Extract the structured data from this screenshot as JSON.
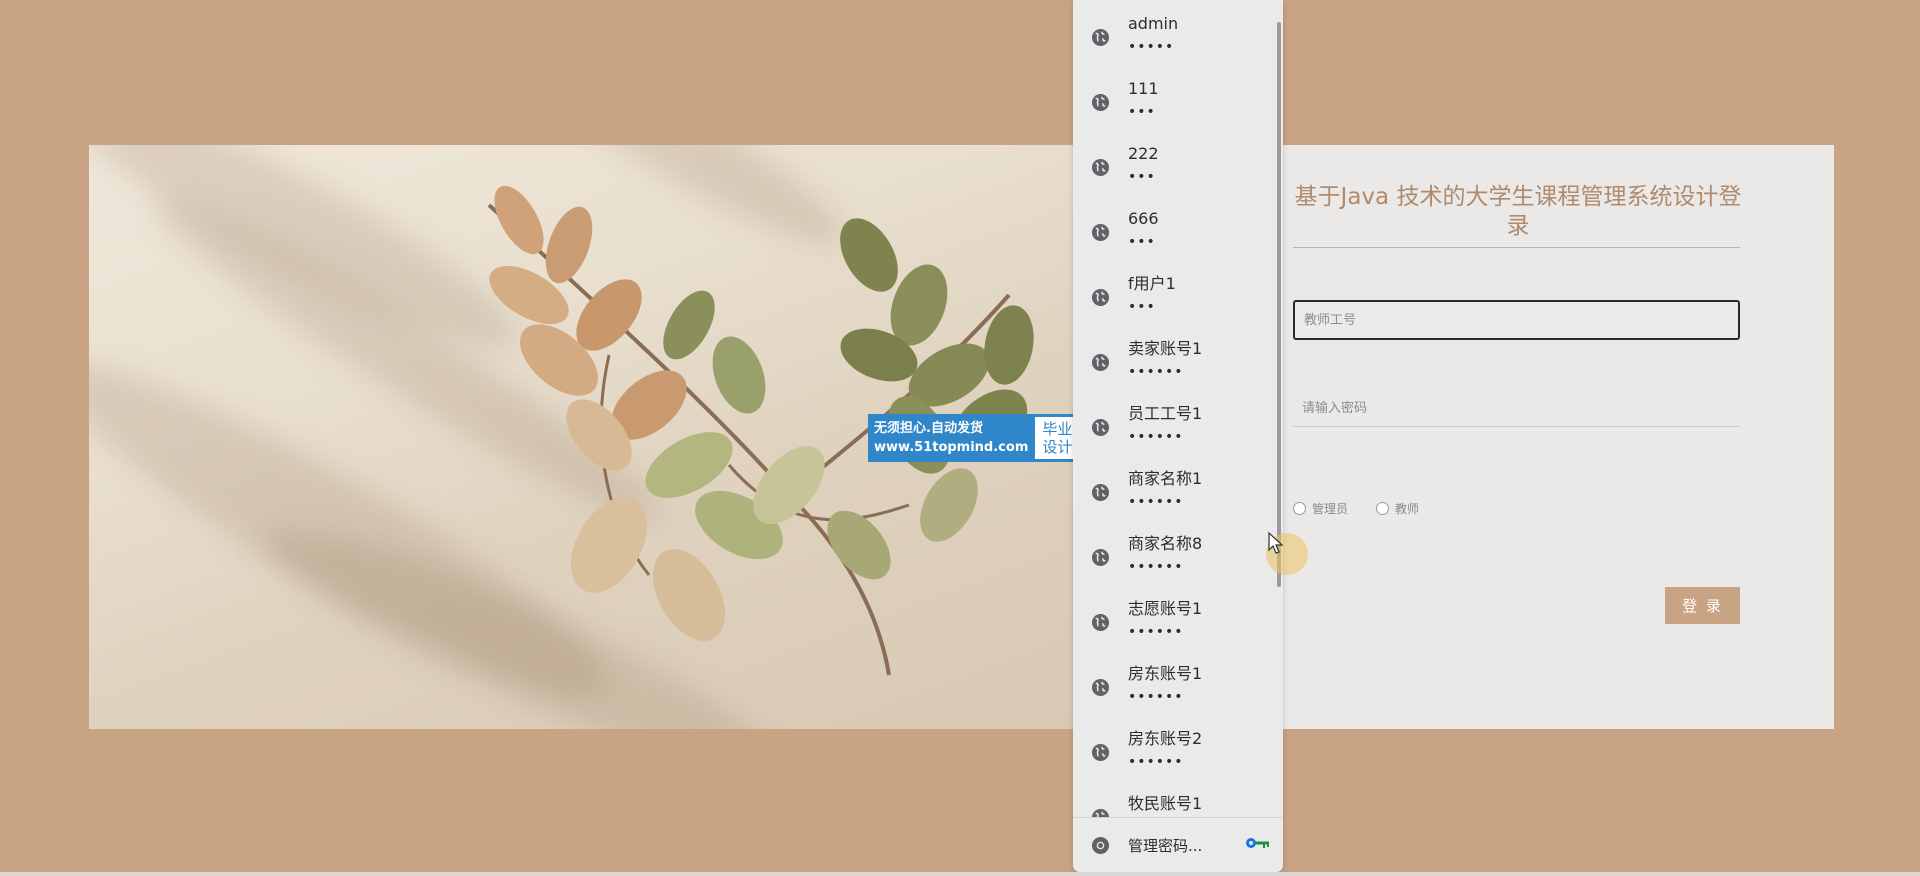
{
  "login": {
    "title": "基于Java 技术的大学生课程管理系统设计登录",
    "username_placeholder": "教师工号",
    "password_placeholder": "请输入密码",
    "roles": [
      "管理员",
      "教师"
    ],
    "login_button": "登 录"
  },
  "watermark": {
    "line1": "无须担心.自动发货",
    "line2": "www.51topmind.com",
    "badge_line1": "毕业",
    "badge_line2": "设计"
  },
  "autofill": {
    "items": [
      {
        "user": "admin",
        "password": "•••••"
      },
      {
        "user": "111",
        "password": "•••"
      },
      {
        "user": "222",
        "password": "•••"
      },
      {
        "user": "666",
        "password": "•••"
      },
      {
        "user": "f用户1",
        "password": "•••"
      },
      {
        "user": "卖家账号1",
        "password": "••••••"
      },
      {
        "user": "员工工号1",
        "password": "••••••"
      },
      {
        "user": "商家名称1",
        "password": "••••••"
      },
      {
        "user": "商家名称8",
        "password": "••••••"
      },
      {
        "user": "志愿账号1",
        "password": "••••••"
      },
      {
        "user": "房东账号1",
        "password": "••••••"
      },
      {
        "user": "房东账号2",
        "password": "••••••"
      },
      {
        "user": "牧民账号1",
        "password": "••••••"
      }
    ],
    "footer_label": "管理密码...",
    "item_icon": "globe-icon",
    "footer_icon": "chrome-icon",
    "key_icon": "key-icon"
  },
  "colors": {
    "page_background": "#c8a485",
    "accent": "#c8a485",
    "title": "#b08a6c",
    "card": "#eae9e8",
    "dropdown": "#eaeaea"
  }
}
